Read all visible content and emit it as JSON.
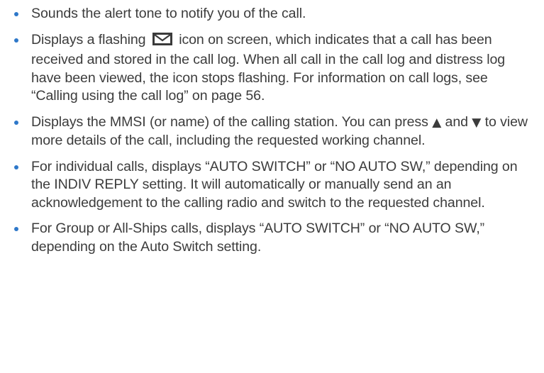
{
  "accent_color": "#2e78c9",
  "bullets": [
    {
      "text": "Sounds the alert tone to notify you of the call."
    },
    {
      "before_icon": "Displays a flashing",
      "icon": "envelope-icon",
      "after_icon": "icon on screen, which indicates that a call has been received and stored in the call log. When all call in the call log and distress log have been viewed, the icon stops flashing.  For information on call logs, see “Calling using the call log” on page 56."
    },
    {
      "part1": "Displays the MMSI (or name) of the calling station. You can press",
      "up_arrow": "▲",
      "part2": "and",
      "down_arrow": "▼",
      "part3": "to view more details of the call, including the requested working channel."
    },
    {
      "text": "For individual calls, displays “AUTO SWITCH” or “NO AUTO SW,” depending on the INDIV REPLY setting. It will automatically or manually send an an acknowledgement to the calling radio and switch to the requested channel."
    },
    {
      "text": "For Group or All-Ships calls, displays “AUTO SWITCH” or “NO AUTO SW,” depending on the Auto Switch setting."
    }
  ]
}
